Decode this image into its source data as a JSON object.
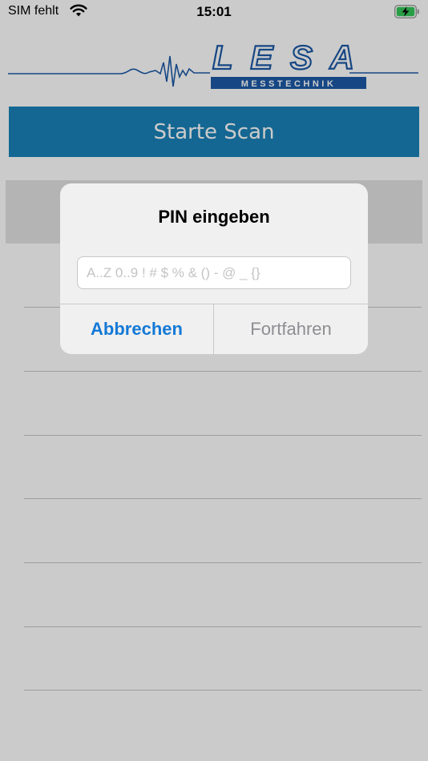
{
  "status_bar": {
    "carrier": "SIM fehlt",
    "time": "15:01"
  },
  "logo": {
    "brand": "LESA",
    "subtitle": "MESSTECHNIK"
  },
  "scan_button": {
    "label": "Starte Scan"
  },
  "dialog": {
    "title": "PIN eingeben",
    "input_value": "",
    "input_placeholder": "A..Z 0..9 ! # $ % & () - @ _ {}",
    "cancel_label": "Abbrechen",
    "continue_label": "Fortfahren"
  },
  "colors": {
    "primary_blue": "#1a82b8",
    "logo_blue": "#1c5aa6",
    "link_blue": "#1479d6",
    "disabled_gray": "#8e8e93",
    "battery_green": "#34c759"
  }
}
